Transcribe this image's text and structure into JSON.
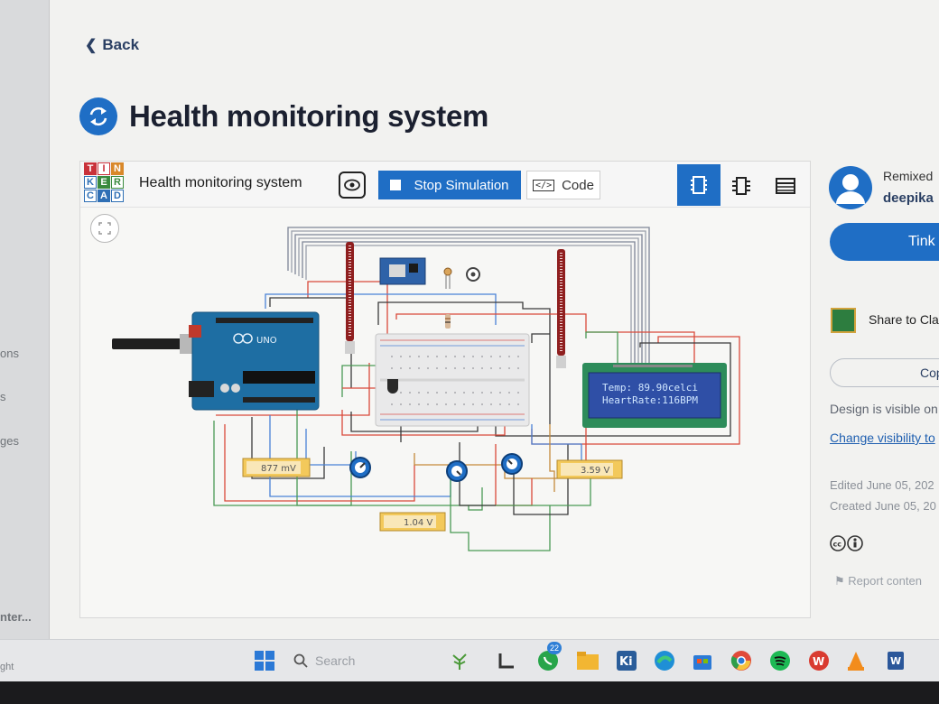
{
  "left_strip": {
    "items": [
      "ons",
      "s",
      "ges",
      "nter..."
    ]
  },
  "header": {
    "back_label": "Back",
    "title": "Health monitoring system"
  },
  "viewer": {
    "logo_letters": [
      "T",
      "I",
      "N",
      "K",
      "E",
      "R",
      "C",
      "A",
      "D"
    ],
    "title": "Health monitoring system",
    "stop_label": "Stop Simulation",
    "code_label": "Code",
    "lcd": {
      "line1": "Temp: 89.90celci",
      "line2": "HeartRate:116BPM"
    },
    "board_label": "UNO",
    "meters": [
      {
        "reading": "877 mV"
      },
      {
        "reading": "3.59 V"
      },
      {
        "reading": "1.04 V"
      }
    ]
  },
  "sidebar": {
    "remixed_from": "Remixed",
    "author": "deepika",
    "tinker_label": "Tink",
    "share_label": "Share to Cla",
    "copy_label": "Cop",
    "visibility_text": "Design is visible on",
    "change_visibility": "Change visibility to",
    "edited": "Edited June 05, 202",
    "created": "Created June 05, 20",
    "report": "Report conten"
  },
  "taskbar": {
    "search_placeholder": "Search",
    "chat_badge": "22",
    "ghost": "ght"
  },
  "colors": {
    "accent": "#1f6ec5",
    "title": "#1b2030",
    "link": "#1f5fb0",
    "pcb": "#1e6ea3",
    "lcd_bg": "#2f4fa6",
    "lcd_text": "#cfe6ff",
    "meter": "#f3c95b"
  }
}
